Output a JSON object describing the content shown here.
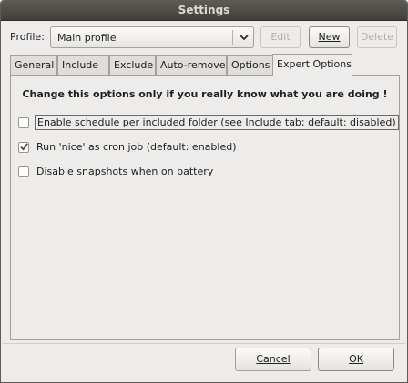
{
  "window": {
    "title": "Settings"
  },
  "profile": {
    "label": "Profile:",
    "selected": "Main profile",
    "edit_label": "Edit",
    "new_label": "New",
    "delete_label": "Delete"
  },
  "tabs": [
    {
      "label": "General"
    },
    {
      "label": "Include"
    },
    {
      "label": "Exclude"
    },
    {
      "label": "Auto-remove"
    },
    {
      "label": "Options"
    },
    {
      "label": "Expert Options"
    }
  ],
  "expert": {
    "warning": "Change this options only if you really know what you are doing !",
    "options": [
      {
        "label": "Enable schedule per included folder (see Include tab; default: disabled)",
        "checked": false
      },
      {
        "label": "Run 'nice' as cron job (default: enabled)",
        "checked": true
      },
      {
        "label": "Disable snapshots when on battery",
        "checked": false
      }
    ]
  },
  "footer": {
    "cancel_label": "Cancel",
    "ok_label": "OK"
  },
  "colors": {
    "titlebar": "#4b4a45",
    "title_text": "#dfdbd2",
    "background": "#edeceb",
    "check": "#4a4946"
  },
  "icons": {
    "combo_arrow": "chevron-down-icon",
    "check": "checkmark-icon"
  }
}
